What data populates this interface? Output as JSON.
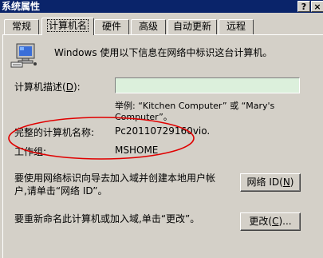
{
  "window": {
    "title": "系统属性",
    "help_button": "?",
    "close_button": "×"
  },
  "tabs": [
    {
      "label": "常规"
    },
    {
      "label": "计算机名"
    },
    {
      "label": "硬件"
    },
    {
      "label": "高级"
    },
    {
      "label": "自动更新"
    },
    {
      "label": "远程"
    }
  ],
  "info": {
    "text": "Windows 使用以下信息在网络中标识这台计算机。",
    "icon": "computer-icon"
  },
  "description": {
    "label": "计算机描述",
    "hotkey": "D",
    "value": "",
    "example_line1": "举例: “Kitchen Computer” 或 “Mary's",
    "example_line2": "Computer”。"
  },
  "full_name": {
    "label": "完整的计算机名称:",
    "value": "Pc20110729160vio."
  },
  "workgroup": {
    "label": "工作组:",
    "value": "MSHOME"
  },
  "network_id": {
    "text_line1": "要使用网络标识向导去加入域并创建本地用户帐",
    "text_line2": "户,请单击“网络 ID”。",
    "button_label": "网络 ID",
    "button_hotkey": "N"
  },
  "rename": {
    "text": "要重新命名此计算机或加入域,单击“更改”。",
    "button_label": "更改",
    "button_hotkey": "C",
    "button_suffix": "..."
  },
  "annotation": {
    "color": "#e00000"
  }
}
